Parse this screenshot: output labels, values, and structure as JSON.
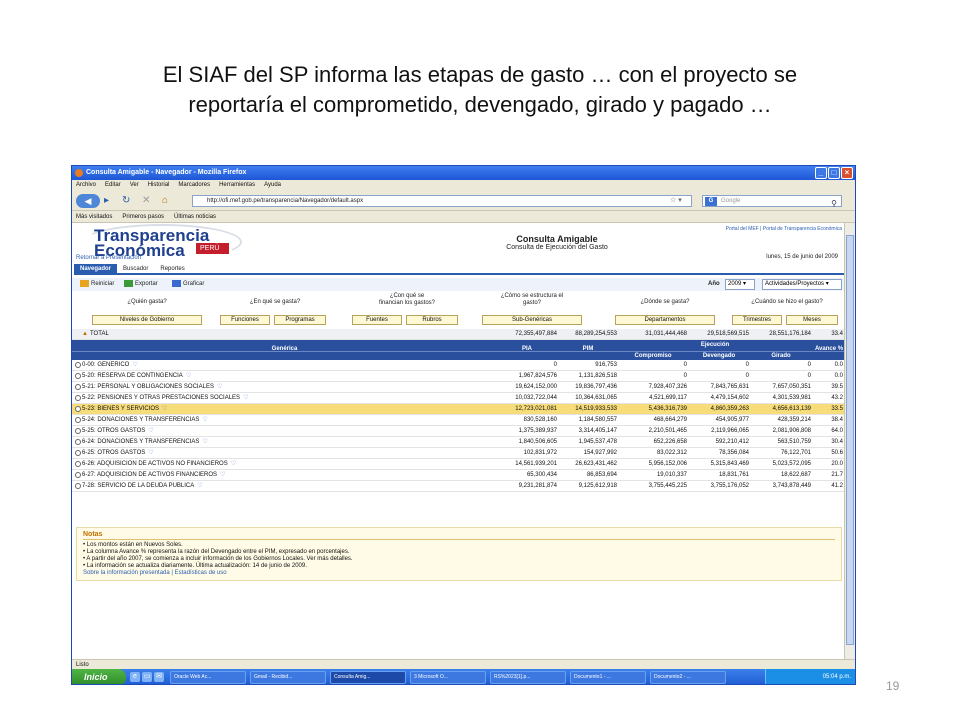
{
  "slide": {
    "title_line1": "El SIAF del SP informa las etapas de gasto … con el proyecto se",
    "title_line2": "reportaría el comprometido, devengado, girado y pagado …",
    "page_number": "19"
  },
  "window": {
    "title": "Consulta Amigable - Navegador - Mozilla Firefox",
    "menu": [
      "Archivo",
      "Editar",
      "Ver",
      "Historial",
      "Marcadores",
      "Herramientas",
      "Ayuda"
    ],
    "url": "http://ofi.mef.gob.pe/transparencia/Navegador/default.aspx",
    "search_placeholder": "Google",
    "bookmarks": [
      "Más visitados",
      "Primeros pasos",
      "Últimas noticias"
    ],
    "status": "Listo"
  },
  "page": {
    "logo_line1": "Transparencia",
    "logo_line2": "Económica",
    "logo_country": "PERÚ",
    "top_links": "Portal del MEF  |  Portal de Transparencia Económica",
    "title": "Consulta Amigable",
    "subtitle": "Consulta de Ejecución del Gasto",
    "date": "lunes, 15 de junio del 2009",
    "back_link": "Retornar a Presentación",
    "tabs": [
      "Navegador",
      "Buscador",
      "Reportes"
    ],
    "tools": {
      "reiniciar": "Reiniciar",
      "exportar": "Exportar",
      "graficar": "Graficar"
    },
    "year_label": "Año",
    "year_value": "2009",
    "view_value": "Actividades/Proyectos",
    "questions": [
      {
        "q": "¿Quién gasta?",
        "buttons": [
          "Niveles de Gobierno"
        ]
      },
      {
        "q": "¿En qué se gasta?",
        "buttons": [
          "Funciones",
          "Programas"
        ]
      },
      {
        "q": "¿Con qué se financian los gastos?",
        "buttons": [
          "Fuentes",
          "Rubros"
        ]
      },
      {
        "q": "¿Cómo se estructura el gasto?",
        "buttons": [
          "Sub-Genéricas"
        ]
      },
      {
        "q": "¿Dónde se gasta?",
        "buttons": [
          "Departamentos"
        ]
      },
      {
        "q": "¿Cuándo se hizo el gasto?",
        "buttons": [
          "Trimestres",
          "Meses"
        ]
      }
    ]
  },
  "table": {
    "total": {
      "label": "TOTAL",
      "pia": "72,355,497,884",
      "pim": "88,289,254,553",
      "comp": "31,031,444,468",
      "dev": "29,518,569,515",
      "gir": "28,551,176,184",
      "av": "33.4"
    },
    "headers": {
      "generica": "Genérica",
      "pia": "PIA",
      "pim": "PIM",
      "ejecucion": "Ejecución",
      "comp": "Compromiso",
      "dev": "Devengado",
      "gir": "Girado",
      "av": "Avance %"
    },
    "rows": [
      {
        "label": "0-00: GENERICO",
        "pia": "0",
        "pim": "916,753",
        "comp": "0",
        "dev": "0",
        "gir": "0",
        "av": "0.0"
      },
      {
        "label": "5-20: RESERVA DE CONTINGENCIA",
        "pia": "1,967,824,576",
        "pim": "1,131,826,518",
        "comp": "0",
        "dev": "0",
        "gir": "0",
        "av": "0.0"
      },
      {
        "label": "5-21: PERSONAL Y OBLIGACIONES SOCIALES",
        "pia": "19,624,152,000",
        "pim": "19,836,797,436",
        "comp": "7,928,407,326",
        "dev": "7,843,765,631",
        "gir": "7,657,050,351",
        "av": "39.5"
      },
      {
        "label": "5-22: PENSIONES Y OTRAS PRESTACIONES SOCIALES",
        "pia": "10,032,722,044",
        "pim": "10,364,631,065",
        "comp": "4,521,699,117",
        "dev": "4,479,154,602",
        "gir": "4,301,539,981",
        "av": "43.2"
      },
      {
        "label": "5-23: BIENES Y SERVICIOS",
        "pia": "12,723,021,081",
        "pim": "14,519,933,533",
        "comp": "5,436,316,739",
        "dev": "4,860,359,263",
        "gir": "4,656,613,139",
        "av": "33.5",
        "highlight": true
      },
      {
        "label": "5-24: DONACIONES Y TRANSFERENCIAS",
        "pia": "830,528,160",
        "pim": "1,184,580,557",
        "comp": "468,664,279",
        "dev": "454,905,977",
        "gir": "428,359,214",
        "av": "38.4"
      },
      {
        "label": "5-25: OTROS GASTOS",
        "pia": "1,375,389,937",
        "pim": "3,314,405,147",
        "comp": "2,210,501,465",
        "dev": "2,119,966,065",
        "gir": "2,081,906,808",
        "av": "64.0"
      },
      {
        "label": "6-24: DONACIONES Y TRANSFERENCIAS",
        "pia": "1,840,506,605",
        "pim": "1,945,537,478",
        "comp": "652,226,658",
        "dev": "592,210,412",
        "gir": "563,510,759",
        "av": "30.4"
      },
      {
        "label": "6-25: OTROS GASTOS",
        "pia": "102,831,972",
        "pim": "154,927,992",
        "comp": "83,022,312",
        "dev": "78,356,084",
        "gir": "76,122,701",
        "av": "50.6"
      },
      {
        "label": "6-26: ADQUISICION DE ACTIVOS NO FINANCIEROS",
        "pia": "14,561,939,201",
        "pim": "26,623,431,462",
        "comp": "5,956,152,006",
        "dev": "5,315,843,469",
        "gir": "5,023,572,095",
        "av": "20.0"
      },
      {
        "label": "6-27: ADQUISICION DE ACTIVOS FINANCIEROS",
        "pia": "65,300,434",
        "pim": "86,853,694",
        "comp": "19,010,337",
        "dev": "18,831,761",
        "gir": "18,622,687",
        "av": "21.7"
      },
      {
        "label": "7-28: SERVICIO DE LA DEUDA PUBLICA",
        "pia": "9,231,281,874",
        "pim": "9,125,612,918",
        "comp": "3,755,445,225",
        "dev": "3,755,176,052",
        "gir": "3,743,878,449",
        "av": "41.2"
      }
    ]
  },
  "notes": {
    "title": "Notas",
    "lines": [
      "• Los montos están en Nuevos Soles.",
      "• La columna Avance % representa la razón del Devengado entre el PIM, expresado en porcentajes.",
      "• A partir del año 2007, se comienza a incluir información de los Gobiernos Locales. Ver más detalles.",
      "• La información se actualiza diariamente. Última actualización: 14 de junio de 2009."
    ],
    "footer": "Sobre la información presentada  |  Estadísticas de uso"
  },
  "taskbar": {
    "start": "Inicio",
    "buttons": [
      "Oracle Web Ac...",
      "Gmail - Recibid...",
      "Consulta Amig...",
      "3 Microsoft O...",
      "RS%2023[1].p...",
      "Documento1 - ...",
      "Documento2 - ..."
    ],
    "clock": "05:04 p.m."
  }
}
